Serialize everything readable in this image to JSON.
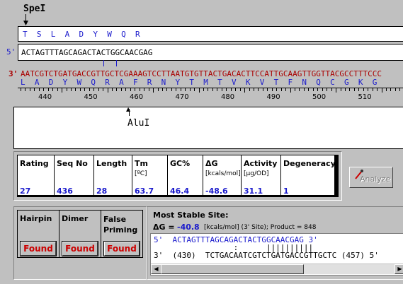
{
  "top_site": {
    "label": "SpeI"
  },
  "protein_box": {
    "text": "T  S  L  A  D  Y  W  Q  R"
  },
  "primer": {
    "prefix": "5'",
    "sequence": "ACTAGTTTAGCAGACTACTGGCAACGAG"
  },
  "template": {
    "prefix": "3'",
    "sequence": "AATCGTCTGATGACCGTTGCTCGAAAGTCCTTAATGTGTTACTGACACTTCCATTGCAAGTTGGTTACGCCTTTCCC",
    "translation": "L  A  D  Y  W  Q  R  A  F  R  N  Y  T  M  T  V  K  V  T  F  N  Q  C  G  K  G",
    "ruler": [
      "440",
      "450",
      "460",
      "470",
      "480",
      "490",
      "500",
      "510"
    ]
  },
  "bottom_site": {
    "label": "AluI"
  },
  "stats": {
    "headers": [
      {
        "main": "Rating",
        "sub": ""
      },
      {
        "main": "Seq No",
        "sub": ""
      },
      {
        "main": "Length",
        "sub": ""
      },
      {
        "main": "Tm",
        "sub": "[ºC]"
      },
      {
        "main": "GC%",
        "sub": ""
      },
      {
        "main": "ΔG",
        "sub": "[kcals/mol]"
      },
      {
        "main": "Activity",
        "sub": "[µg/OD]"
      },
      {
        "main": "Degeneracy",
        "sub": ""
      }
    ],
    "values": [
      "27",
      "436",
      "28",
      "63.7",
      "46.4",
      "-48.6",
      "31.1",
      "1"
    ]
  },
  "analyze_button": {
    "label": "Analyze"
  },
  "checks": [
    {
      "label": "Hairpin",
      "status": "Found"
    },
    {
      "label": "Dimer",
      "status": "Found"
    },
    {
      "label": "False Priming",
      "status": "Found"
    }
  ],
  "stable_site": {
    "title": "Most Stable Site:",
    "dg_label": "ΔG =",
    "dg_value": "-40.8",
    "dg_unit": "[kcals/mol] (3' Site); Product = 848",
    "line1": "5'  ACTAGTTTAGCAGACTACTGGCAACGAG 3'",
    "line2": "                 :      ||||||||||",
    "line3": "3'  (430)  TCTGACAATCGTCTGATGACCGTTGCTC (457) 5'"
  },
  "colors": {
    "blue": "#1a1acc",
    "red": "#cc0000",
    "darkred": "#aa0000"
  }
}
